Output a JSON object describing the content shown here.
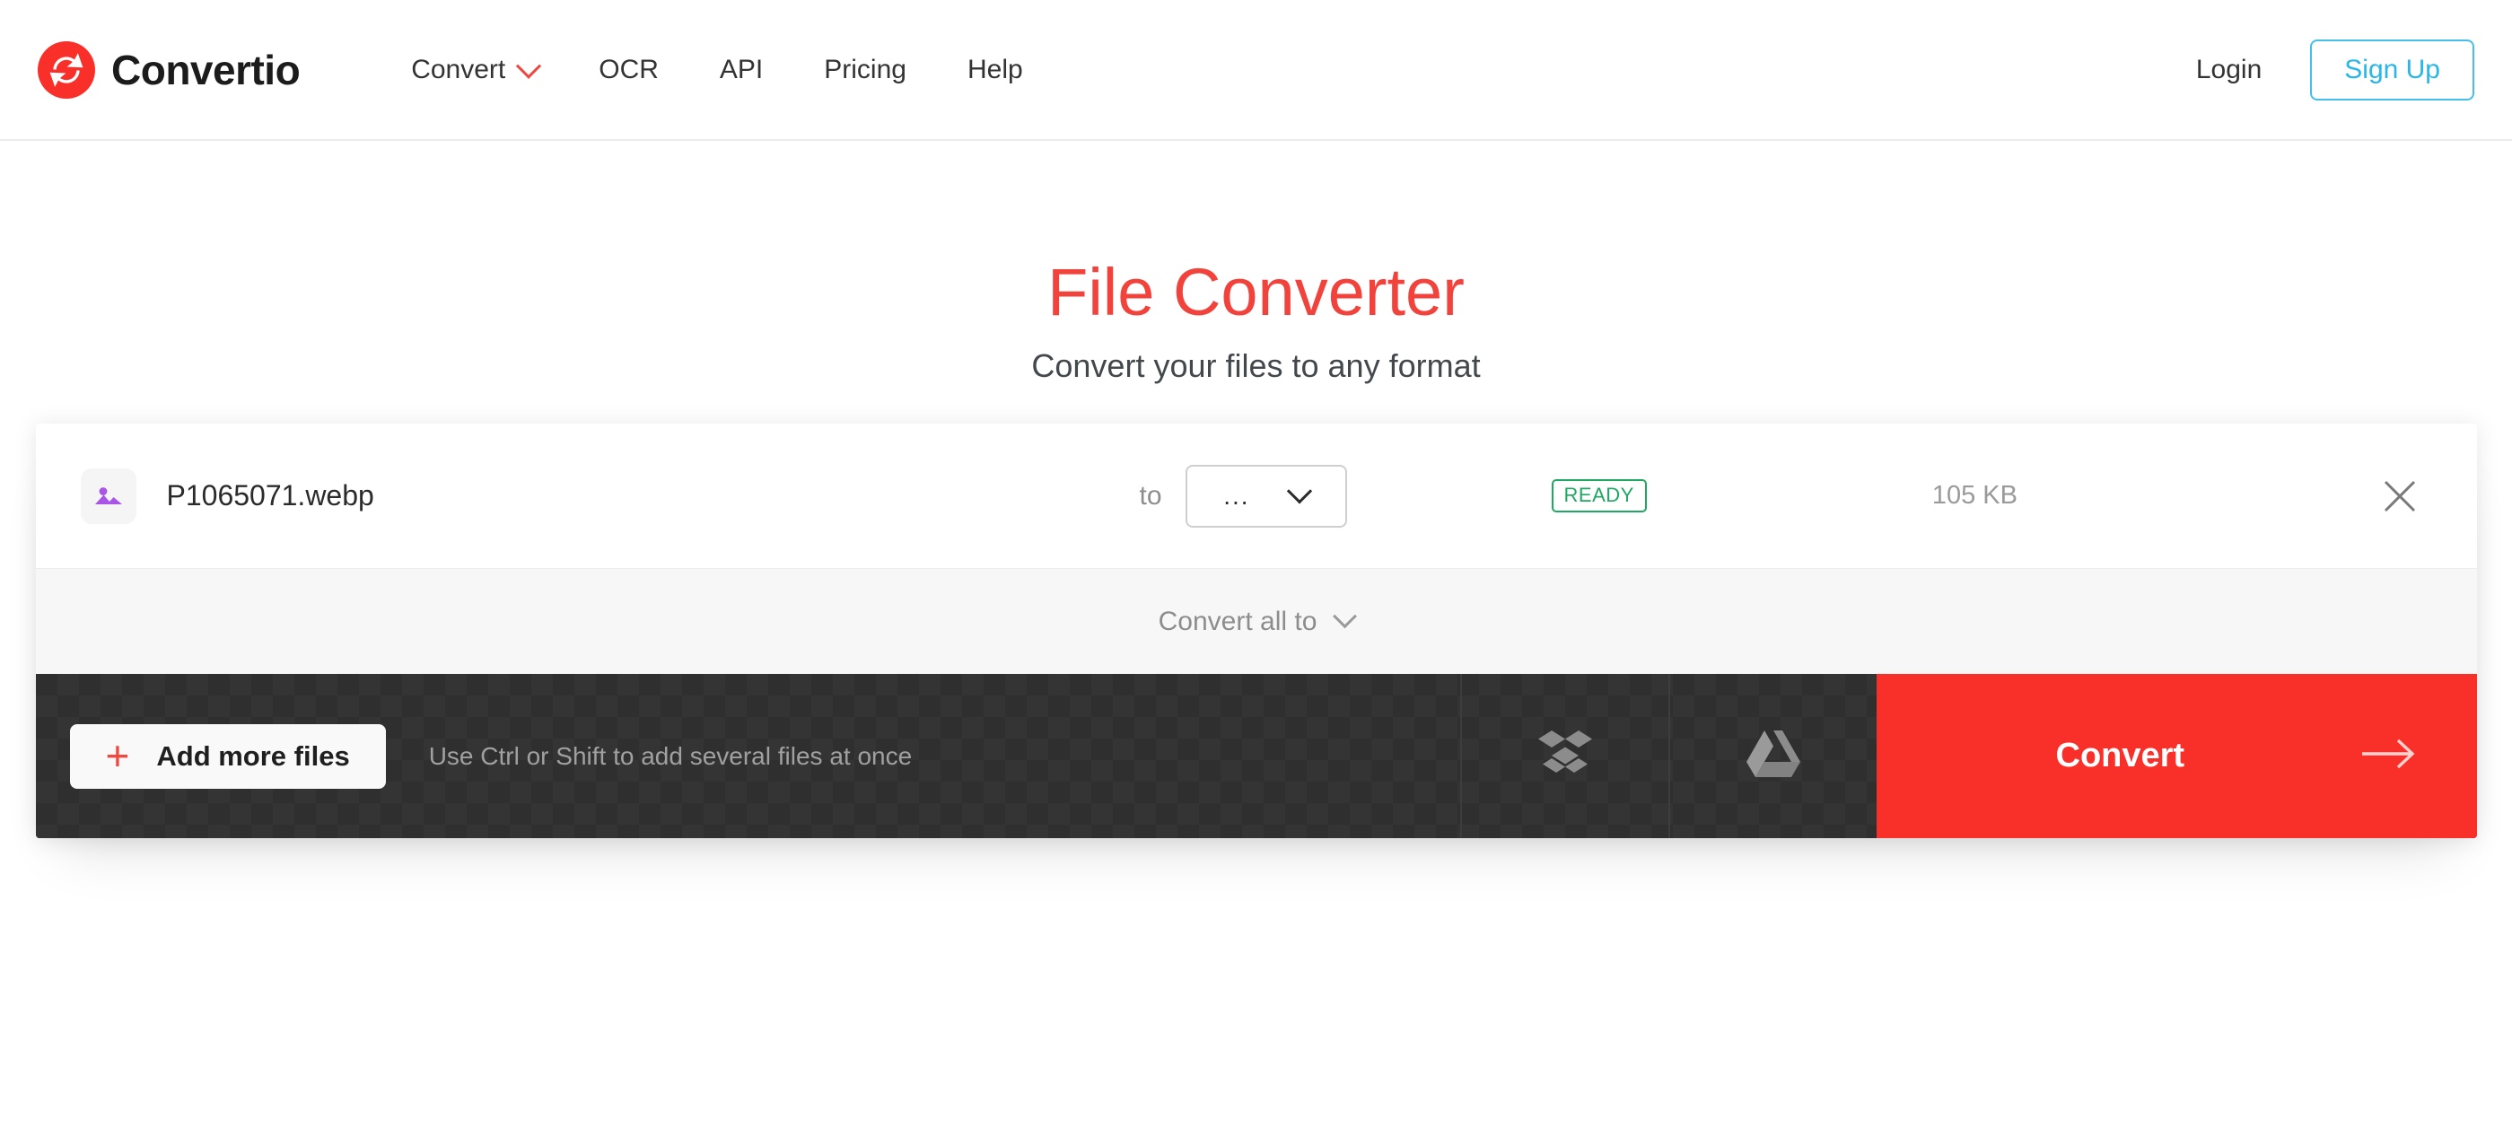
{
  "header": {
    "brand": {
      "name": "Convertio",
      "logo_icon": "convertio-refresh-icon",
      "logo_color": "#F9302A"
    },
    "nav": [
      {
        "label": "Convert",
        "has_dropdown": true,
        "chevron_icon": "chevron-down-icon"
      },
      {
        "label": "OCR",
        "has_dropdown": false
      },
      {
        "label": "API",
        "has_dropdown": false
      },
      {
        "label": "Pricing",
        "has_dropdown": false
      },
      {
        "label": "Help",
        "has_dropdown": false
      }
    ],
    "login_label": "Login",
    "signup_label": "Sign Up",
    "signup_color": "#29B6E8"
  },
  "hero": {
    "title": "File Converter",
    "title_color": "#F2423C",
    "subtitle": "Convert your files to any format"
  },
  "file_row": {
    "file_icon": "image-file-icon",
    "file_name": "P1065071.webp",
    "to_label": "to",
    "format_value": "...",
    "format_chevron_icon": "chevron-down-icon",
    "status": "READY",
    "status_color": "#1FA862",
    "size": "105 KB",
    "remove_icon": "close-icon"
  },
  "convert_all": {
    "label": "Convert all to",
    "chevron_icon": "chevron-down-icon"
  },
  "action_bar": {
    "add_more_label": "Add more files",
    "add_more_icon": "plus-icon",
    "hint": "Use Ctrl or Shift to add several files at once",
    "dropbox_icon": "dropbox-icon",
    "google_drive_icon": "google-drive-icon",
    "convert_label": "Convert",
    "convert_arrow_icon": "arrow-right-icon",
    "convert_color": "#F9302A"
  }
}
